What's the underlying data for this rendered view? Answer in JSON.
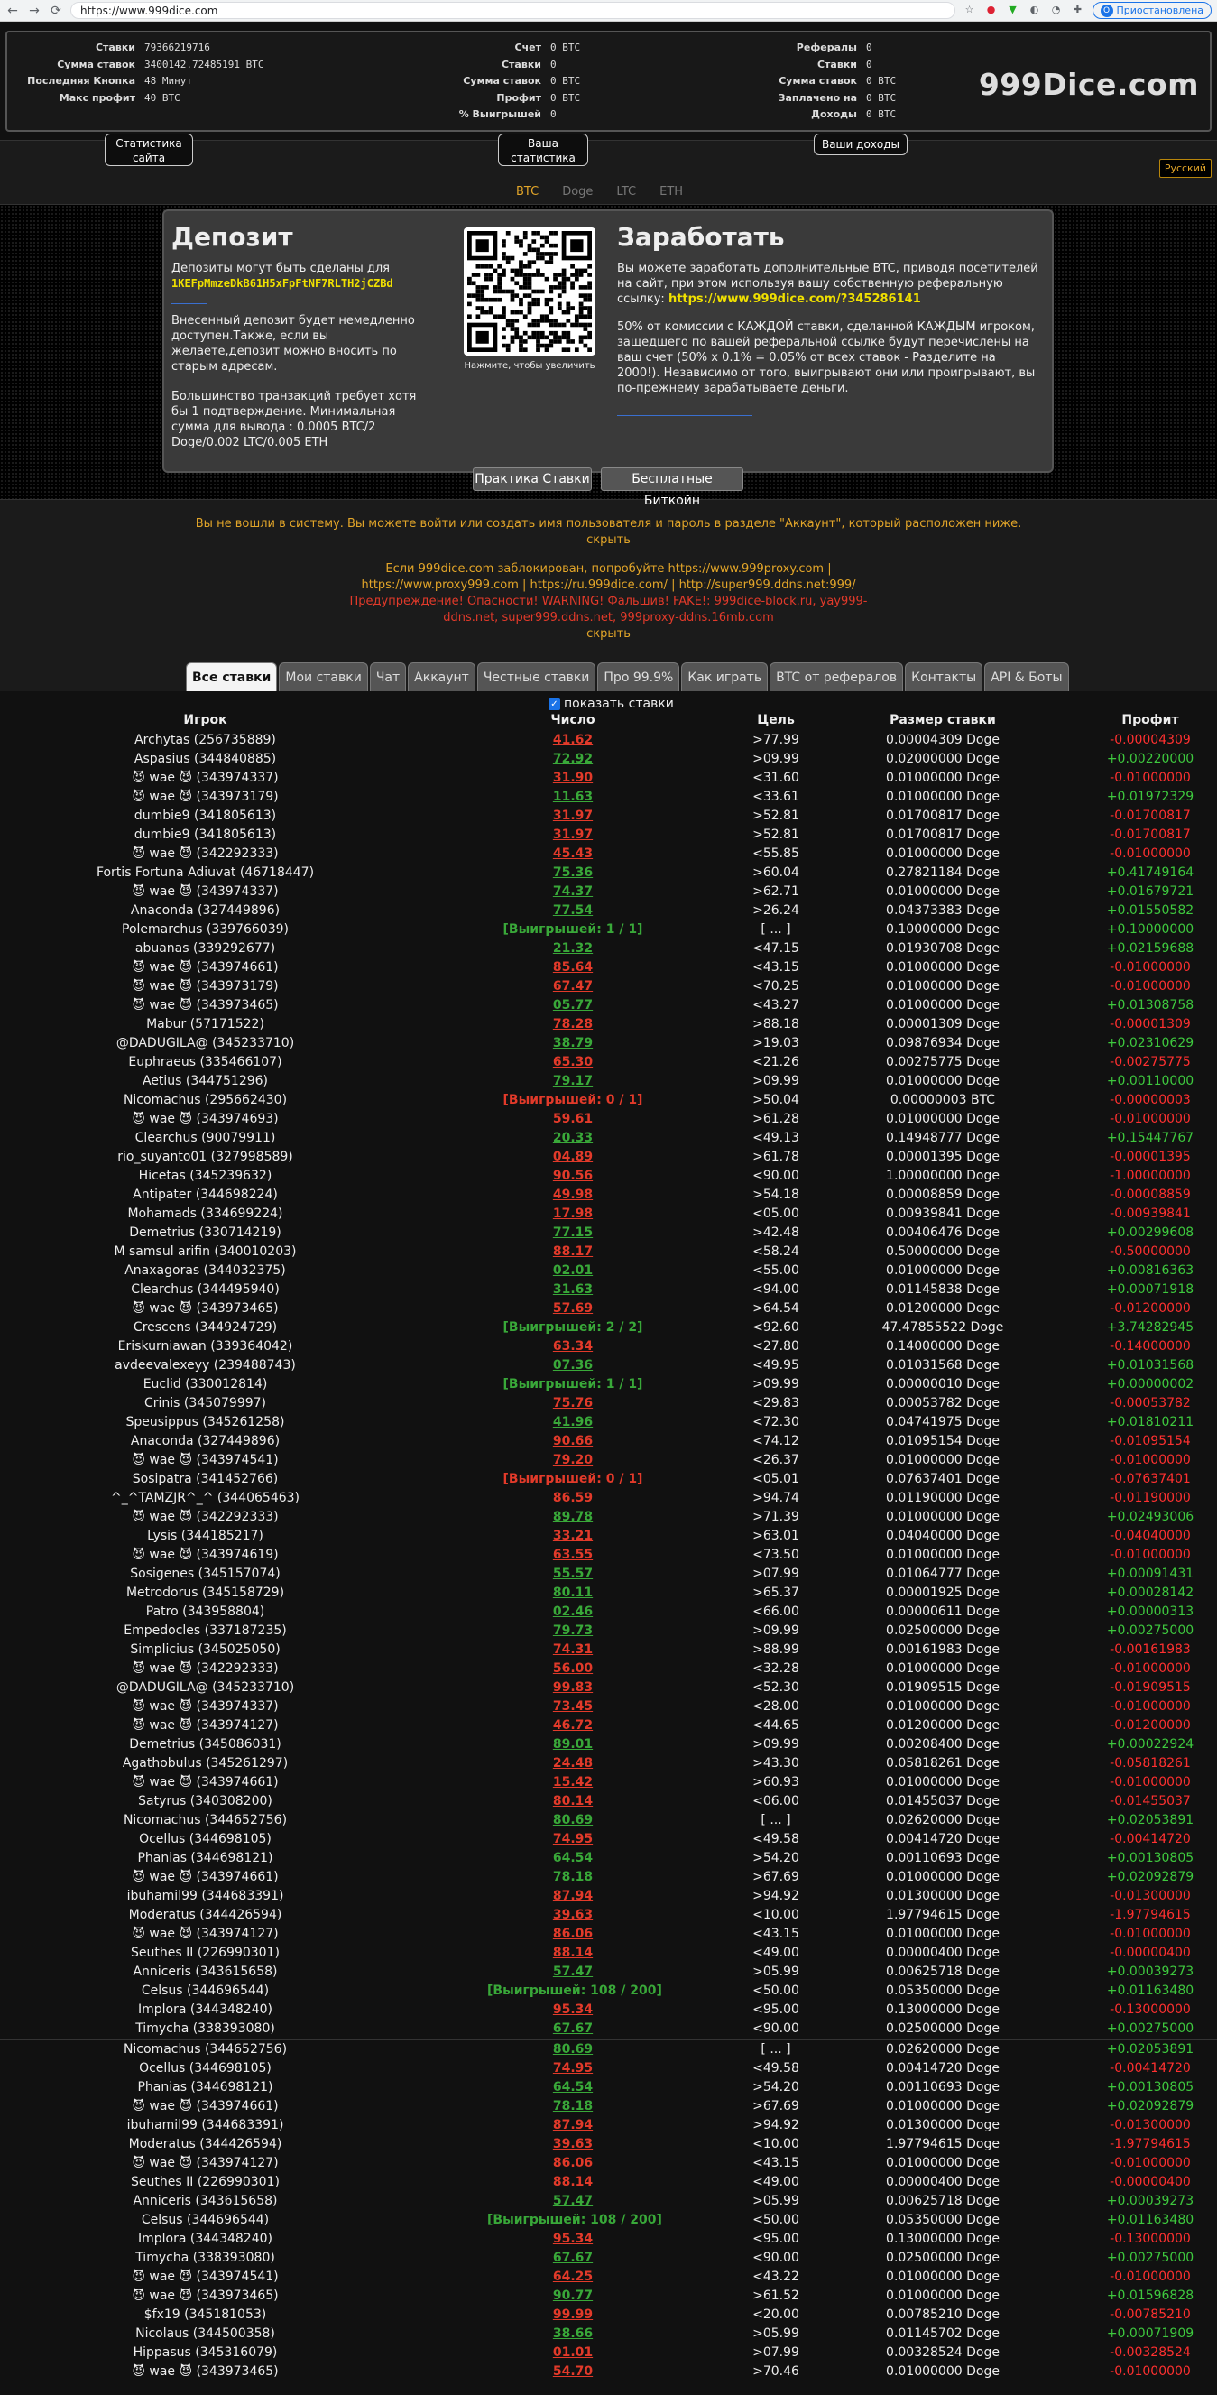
{
  "browser": {
    "url": "https://www.999dice.com",
    "profile_initial": "O",
    "pause_label": "Приостановлена"
  },
  "site_stats": {
    "rows": [
      {
        "label": "Ставки",
        "value": "79366219716"
      },
      {
        "label": "Сумма ставок",
        "value": "3400142.72485191 BTC"
      },
      {
        "label": "Последняя Кнопка",
        "value": "48 Минут"
      },
      {
        "label": "Макс профит",
        "value": "40 BTC"
      }
    ],
    "button": "Статистика сайта"
  },
  "your_stats": {
    "rows": [
      {
        "label": "Счет",
        "value": "0 BTC"
      },
      {
        "label": "Ставки",
        "value": "0"
      },
      {
        "label": "Сумма ставок",
        "value": "0 BTC"
      },
      {
        "label": "Профит",
        "value": "0 BTC"
      },
      {
        "label": "% Выигрышей",
        "value": "0"
      }
    ],
    "button": "Ваша статистика"
  },
  "referrals": {
    "rows": [
      {
        "label": "Рефералы",
        "value": "0"
      },
      {
        "label": "Ставки",
        "value": "0"
      },
      {
        "label": "Сумма ставок",
        "value": "0 BTC"
      },
      {
        "label": "Заплачено на",
        "value": "0 BTC"
      },
      {
        "label": "Доходы",
        "value": "0 BTC"
      }
    ],
    "button": "Ваши доходы"
  },
  "brand": "999Dice.com",
  "language": "Русский",
  "currencies": [
    "BTC",
    "Doge",
    "LTC",
    "ETH"
  ],
  "deposit": {
    "title": "Депозит",
    "intro": "Депозиты могут быть сделаны для",
    "address": "1KEFpMmzeDkB61H5xFpFtNF7RLTH2jCZBd",
    "p2": "Внесенный депозит будет немедленно доступен.Также, если вы желаете,депозит можно вносить по старым адресам.",
    "p3": "Большинство транзакций требует хотя бы 1 подтверждение. Минимальная сумма для вывода : 0.0005 BTC/2 Doge/0.002 LTC/0.005 ETH"
  },
  "qr_caption": "Нажмите, чтобы увеличить",
  "earn": {
    "title": "Заработать",
    "p1": "Вы можете заработать дополнительные BTC, приводя посетителей на сайт, при этом используя вашу собственную реферальную ссылку:",
    "ref_link": "https://www.999dice.com/?345286141",
    "p2": "50% от комиссии с КАЖДОЙ ставки, сделанной КАЖДЫМ игроком, защедшего по вашей реферальной ссылке будут перечислены на ваш счет (50% x 0.1% = 0.05% от всех ставок - Разделите на 2000!). Независимо от того, выигрывают они или проигрывают, вы по-прежнему зарабатываете деньги."
  },
  "practice_button": "Практика Ставки",
  "free_button": "Бесплатные Биткойн",
  "notice1": "Вы не вошли в систему. Вы можете войти или создать имя пользователя и пароль в разделе \"Аккаунт\", который расположен ниже.",
  "hide": "скрыть",
  "notice2a": "Если 999dice.com заблокирован, попробуйте https://www.999proxy.com |",
  "notice2b": "https://www.proxy999.com | https://ru.999dice.com/ | http://super999.ddns.net:999/",
  "warn1": "Предупреждение! Опасности! WARNING! Фальшив! FAKE!: 999dice-block.ru, yay999-",
  "warn2": "ddns.net, super999.ddns.net, 999proxy-ddns.16mb.com",
  "tabs": [
    "Все ставки",
    "Мои ставки",
    "Чат",
    "Аккаунт",
    "Честные ставки",
    "Про 99.9%",
    "Как играть",
    "BTC от рефералов",
    "Контакты",
    "API & Боты"
  ],
  "show_bets_label": "показать ставки",
  "columns": {
    "player": "Игрок",
    "number": "Число",
    "target": "Цель",
    "size": "Размер ставки",
    "profit": "Профит"
  },
  "bets": [
    [
      "Archytas (256735889)",
      "41.62",
      "r",
      ">77.99",
      "0.00004309 Doge",
      "-0.00004309",
      "r"
    ],
    [
      "Aspasius (344840885)",
      "72.92",
      "g",
      ">09.99",
      "0.02000000 Doge",
      "+0.00220000",
      "g"
    ],
    [
      "😈 wae 😈 (343974337)",
      "31.90",
      "r",
      "<31.60",
      "0.01000000 Doge",
      "-0.01000000",
      "r"
    ],
    [
      "😈 wae 😈 (343973179)",
      "11.63",
      "g",
      "<33.61",
      "0.01000000 Doge",
      "+0.01972329",
      "g"
    ],
    [
      "dumbie9 (341805613)",
      "31.97",
      "r",
      ">52.81",
      "0.01700817 Doge",
      "-0.01700817",
      "r"
    ],
    [
      "dumbie9 (341805613)",
      "31.97",
      "r",
      ">52.81",
      "0.01700817 Doge",
      "-0.01700817",
      "r"
    ],
    [
      "😈 wae 😈 (342292333)",
      "45.43",
      "r",
      "<55.85",
      "0.01000000 Doge",
      "-0.01000000",
      "r"
    ],
    [
      "Fortis Fortuna Adiuvat (46718447)",
      "75.36",
      "g",
      ">60.04",
      "0.27821184 Doge",
      "+0.41749164",
      "g"
    ],
    [
      "😈 wae 😈 (343974337)",
      "74.37",
      "g",
      ">62.71",
      "0.01000000 Doge",
      "+0.01679721",
      "g"
    ],
    [
      "Anaconda (327449896)",
      "77.54",
      "g",
      ">26.24",
      "0.04373383 Doge",
      "+0.01550582",
      "g"
    ],
    [
      "Polemarchus (339766039)",
      "[Выигрышей: 1 / 1]",
      "wg",
      "[ ... ]",
      "0.10000000 Doge",
      "+0.10000000",
      "g"
    ],
    [
      "abuanas (339292677)",
      "21.32",
      "g",
      "<47.15",
      "0.01930708 Doge",
      "+0.02159688",
      "g"
    ],
    [
      "😈 wae 😈 (343974661)",
      "85.64",
      "r",
      "<43.15",
      "0.01000000 Doge",
      "-0.01000000",
      "r"
    ],
    [
      "😈 wae 😈 (343973179)",
      "67.47",
      "r",
      "<70.25",
      "0.01000000 Doge",
      "-0.01000000",
      "r"
    ],
    [
      "😈 wae 😈 (343973465)",
      "05.77",
      "g",
      "<43.27",
      "0.01000000 Doge",
      "+0.01308758",
      "g"
    ],
    [
      "Mabur (57171522)",
      "78.28",
      "r",
      ">88.18",
      "0.00001309 Doge",
      "-0.00001309",
      "r"
    ],
    [
      "@DADUGILA@ (345233710)",
      "38.79",
      "g",
      ">19.03",
      "0.09876934 Doge",
      "+0.02310629",
      "g"
    ],
    [
      "Euphraeus (335466107)",
      "65.30",
      "r",
      "<21.26",
      "0.00275775 Doge",
      "-0.00275775",
      "r"
    ],
    [
      "Aetius (344751296)",
      "79.17",
      "g",
      ">09.99",
      "0.01000000 Doge",
      "+0.00110000",
      "g"
    ],
    [
      "Nicomachus (295662430)",
      "[Выигрышей: 0 / 1]",
      "wr",
      ">50.04",
      "0.00000003 BTC",
      "-0.00000003",
      "r"
    ],
    [
      "😈 wae 😈 (343974693)",
      "59.61",
      "r",
      ">61.28",
      "0.01000000 Doge",
      "-0.01000000",
      "r"
    ],
    [
      "Clearchus (90079911)",
      "20.33",
      "g",
      "<49.13",
      "0.14948777 Doge",
      "+0.15447767",
      "g"
    ],
    [
      "rio_suyanto01 (327998589)",
      "04.89",
      "r",
      ">61.78",
      "0.00001395 Doge",
      "-0.00001395",
      "r"
    ],
    [
      "Hicetas (345239632)",
      "90.56",
      "r",
      "<90.00",
      "1.00000000 Doge",
      "-1.00000000",
      "r"
    ],
    [
      "Antipater (344698224)",
      "49.98",
      "r",
      ">54.18",
      "0.00008859 Doge",
      "-0.00008859",
      "r"
    ],
    [
      "Mohamads (334699224)",
      "17.98",
      "r",
      "<05.00",
      "0.00939841 Doge",
      "-0.00939841",
      "r"
    ],
    [
      "Demetrius (330714219)",
      "77.15",
      "g",
      ">42.48",
      "0.00406476 Doge",
      "+0.00299608",
      "g"
    ],
    [
      "M samsul arifin (340010203)",
      "88.17",
      "r",
      "<58.24",
      "0.50000000 Doge",
      "-0.50000000",
      "r"
    ],
    [
      "Anaxagoras (344032375)",
      "02.01",
      "g",
      "<55.00",
      "0.01000000 Doge",
      "+0.00816363",
      "g"
    ],
    [
      "Clearchus (344495940)",
      "31.63",
      "g",
      "<94.00",
      "0.01145838 Doge",
      "+0.00071918",
      "g"
    ],
    [
      "😈 wae 😈 (343973465)",
      "57.69",
      "r",
      ">64.54",
      "0.01200000 Doge",
      "-0.01200000",
      "r"
    ],
    [
      "Crescens (344924729)",
      "[Выигрышей: 2 / 2]",
      "wg",
      "<92.60",
      "47.47855522 Doge",
      "+3.74282945",
      "g"
    ],
    [
      "Eriskurniawan (339364042)",
      "63.34",
      "r",
      "<27.80",
      "0.14000000 Doge",
      "-0.14000000",
      "r"
    ],
    [
      "avdeevalexeyy (239488743)",
      "07.36",
      "g",
      "<49.95",
      "0.01031568 Doge",
      "+0.01031568",
      "g"
    ],
    [
      "Euclid (330012814)",
      "[Выигрышей: 1 / 1]",
      "wg",
      ">09.99",
      "0.00000010 Doge",
      "+0.00000002",
      "g"
    ],
    [
      "Crinis (345079997)",
      "75.76",
      "r",
      "<29.83",
      "0.00053782 Doge",
      "-0.00053782",
      "r"
    ],
    [
      "Speusippus (345261258)",
      "41.96",
      "g",
      "<72.30",
      "0.04741975 Doge",
      "+0.01810211",
      "g"
    ],
    [
      "Anaconda (327449896)",
      "90.66",
      "r",
      "<74.12",
      "0.01095154 Doge",
      "-0.01095154",
      "r"
    ],
    [
      "😈 wae 😈 (343974541)",
      "79.20",
      "r",
      "<26.37",
      "0.01000000 Doge",
      "-0.01000000",
      "r"
    ],
    [
      "Sosipatra (341452766)",
      "[Выигрышей: 0 / 1]",
      "wr",
      "<05.01",
      "0.07637401 Doge",
      "-0.07637401",
      "r"
    ],
    [
      "^_^TAMZJR^_^ (344065463)",
      "86.59",
      "r",
      ">94.74",
      "0.01190000 Doge",
      "-0.01190000",
      "r"
    ],
    [
      "😈 wae 😈 (342292333)",
      "89.78",
      "g",
      ">71.39",
      "0.01000000 Doge",
      "+0.02493006",
      "g"
    ],
    [
      "Lysis (344185217)",
      "33.21",
      "r",
      ">63.01",
      "0.04040000 Doge",
      "-0.04040000",
      "r"
    ],
    [
      "😈 wae 😈 (343974619)",
      "63.55",
      "r",
      "<73.50",
      "0.01000000 Doge",
      "-0.01000000",
      "r"
    ],
    [
      "Sosigenes (345157074)",
      "55.57",
      "g",
      ">07.99",
      "0.01064777 Doge",
      "+0.00091431",
      "g"
    ],
    [
      "Metrodorus (345158729)",
      "80.11",
      "g",
      ">65.37",
      "0.00001925 Doge",
      "+0.00028142",
      "g"
    ],
    [
      "Patro (343958804)",
      "02.46",
      "g",
      "<66.00",
      "0.00000611 Doge",
      "+0.00000313",
      "g"
    ],
    [
      "Empedocles (337187235)",
      "79.73",
      "g",
      ">09.99",
      "0.02500000 Doge",
      "+0.00275000",
      "g"
    ],
    [
      "Simplicius (345025050)",
      "74.31",
      "r",
      ">88.99",
      "0.00161983 Doge",
      "-0.00161983",
      "r"
    ],
    [
      "😈 wae 😈 (342292333)",
      "56.00",
      "r",
      "<32.28",
      "0.01000000 Doge",
      "-0.01000000",
      "r"
    ],
    [
      "@DADUGILA@ (345233710)",
      "99.83",
      "r",
      "<52.30",
      "0.01909515 Doge",
      "-0.01909515",
      "r"
    ],
    [
      "😈 wae 😈 (343974337)",
      "73.45",
      "r",
      "<28.00",
      "0.01000000 Doge",
      "-0.01000000",
      "r"
    ],
    [
      "😈 wae 😈 (343974127)",
      "46.72",
      "r",
      "<44.65",
      "0.01200000 Doge",
      "-0.01200000",
      "r"
    ],
    [
      "Demetrius (345086031)",
      "89.01",
      "g",
      ">09.99",
      "0.00208400 Doge",
      "+0.00022924",
      "g"
    ],
    [
      "Agathobulus (345261297)",
      "24.48",
      "r",
      ">43.30",
      "0.05818261 Doge",
      "-0.05818261",
      "r"
    ],
    [
      "😈 wae 😈 (343974661)",
      "15.42",
      "r",
      ">60.93",
      "0.01000000 Doge",
      "-0.01000000",
      "r"
    ],
    [
      "Satyrus (340308200)",
      "80.14",
      "r",
      "<06.00",
      "0.01455037 Doge",
      "-0.01455037",
      "r"
    ],
    [
      "Nicomachus (344652756)",
      "80.69",
      "g",
      "[ ... ]",
      "0.02620000 Doge",
      "+0.02053891",
      "g"
    ],
    [
      "Ocellus (344698105)",
      "74.95",
      "r",
      "<49.58",
      "0.00414720 Doge",
      "-0.00414720",
      "r"
    ],
    [
      "Phanias (344698121)",
      "64.54",
      "g",
      ">54.20",
      "0.00110693 Doge",
      "+0.00130805",
      "g"
    ],
    [
      "😈 wae 😈 (343974661)",
      "78.18",
      "g",
      ">67.69",
      "0.01000000 Doge",
      "+0.02092879",
      "g"
    ],
    [
      "ibuhamil99 (344683391)",
      "87.94",
      "r",
      ">94.92",
      "0.01300000 Doge",
      "-0.01300000",
      "r"
    ],
    [
      "Moderatus (344426594)",
      "39.63",
      "r",
      "<10.00",
      "1.97794615 Doge",
      "-1.97794615",
      "r"
    ],
    [
      "😈 wae 😈 (343974127)",
      "86.06",
      "r",
      "<43.15",
      "0.01000000 Doge",
      "-0.01000000",
      "r"
    ],
    [
      "Seuthes II (226990301)",
      "88.14",
      "r",
      "<49.00",
      "0.00000400 Doge",
      "-0.00000400",
      "r"
    ],
    [
      "Anniceris (343615658)",
      "57.47",
      "g",
      ">05.99",
      "0.00625718 Doge",
      "+0.00039273",
      "g"
    ],
    [
      "Celsus (344696544)",
      "[Выигрышей: 108 / 200]",
      "wg",
      "<50.00",
      "0.05350000 Doge",
      "+0.01163480",
      "g"
    ],
    [
      "Implora (344348240)",
      "95.34",
      "r",
      "<95.00",
      "0.13000000 Doge",
      "-0.13000000",
      "r"
    ],
    [
      "Timycha (338393080)",
      "67.67",
      "g",
      "<90.00",
      "0.02500000 Doge",
      "+0.00275000",
      "g"
    ],
    [
      "SEP"
    ],
    [
      "Nicomachus (344652756)",
      "80.69",
      "g",
      "[ ... ]",
      "0.02620000 Doge",
      "+0.02053891",
      "g"
    ],
    [
      "Ocellus (344698105)",
      "74.95",
      "r",
      "<49.58",
      "0.00414720 Doge",
      "-0.00414720",
      "r"
    ],
    [
      "Phanias (344698121)",
      "64.54",
      "g",
      ">54.20",
      "0.00110693 Doge",
      "+0.00130805",
      "g"
    ],
    [
      "😈 wae 😈 (343974661)",
      "78.18",
      "g",
      ">67.69",
      "0.01000000 Doge",
      "+0.02092879",
      "g"
    ],
    [
      "ibuhamil99 (344683391)",
      "87.94",
      "r",
      ">94.92",
      "0.01300000 Doge",
      "-0.01300000",
      "r"
    ],
    [
      "Moderatus (344426594)",
      "39.63",
      "r",
      "<10.00",
      "1.97794615 Doge",
      "-1.97794615",
      "r"
    ],
    [
      "😈 wae 😈 (343974127)",
      "86.06",
      "r",
      "<43.15",
      "0.01000000 Doge",
      "-0.01000000",
      "r"
    ],
    [
      "Seuthes II (226990301)",
      "88.14",
      "r",
      "<49.00",
      "0.00000400 Doge",
      "-0.00000400",
      "r"
    ],
    [
      "Anniceris (343615658)",
      "57.47",
      "g",
      ">05.99",
      "0.00625718 Doge",
      "+0.00039273",
      "g"
    ],
    [
      "Celsus (344696544)",
      "[Выигрышей: 108 / 200]",
      "wg",
      "<50.00",
      "0.05350000 Doge",
      "+0.01163480",
      "g"
    ],
    [
      "Implora (344348240)",
      "95.34",
      "r",
      "<95.00",
      "0.13000000 Doge",
      "-0.13000000",
      "r"
    ],
    [
      "Timycha (338393080)",
      "67.67",
      "g",
      "<90.00",
      "0.02500000 Doge",
      "+0.00275000",
      "g"
    ],
    [
      "😈 wae 😈 (343974541)",
      "64.25",
      "r",
      "<43.22",
      "0.01000000 Doge",
      "-0.01000000",
      "r"
    ],
    [
      "😈 wae 😈 (343973465)",
      "90.77",
      "g",
      ">61.52",
      "0.01000000 Doge",
      "+0.01596828",
      "g"
    ],
    [
      "$fx19 (345181053)",
      "99.99",
      "r",
      "<20.00",
      "0.00785210 Doge",
      "-0.00785210",
      "r"
    ],
    [
      "Nicolaus (344500358)",
      "38.66",
      "g",
      ">05.99",
      "0.01145702 Doge",
      "+0.00071909",
      "g"
    ],
    [
      "Hippasus (345316079)",
      "01.01",
      "r",
      ">07.99",
      "0.00328524 Doge",
      "-0.00328524",
      "r"
    ],
    [
      "😈 wae 😈 (343973465)",
      "54.70",
      "r",
      ">70.46",
      "0.01000000 Doge",
      "-0.01000000",
      "r"
    ]
  ]
}
